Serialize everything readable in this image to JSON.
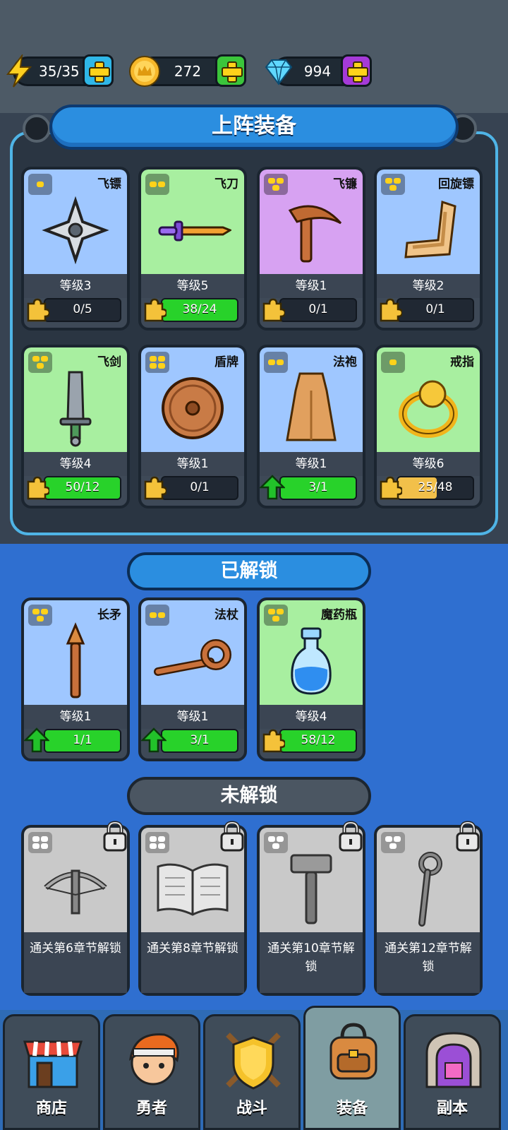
{
  "resources": {
    "energy": "35/35",
    "gold": "272",
    "gems": "994"
  },
  "equipped": {
    "title": "上阵装备",
    "cards": [
      {
        "name": "飞镖",
        "level": "等级3",
        "progress": "0/5",
        "fill": 0,
        "color": "#9fc7ff",
        "rarity": 1,
        "icon": "shuriken-icon"
      },
      {
        "name": "飞刀",
        "level": "等级5",
        "progress": "38/24",
        "fill": 1,
        "color": "#a8efa0",
        "rarity": 2,
        "icon": "dagger-icon"
      },
      {
        "name": "飞镰",
        "level": "等级1",
        "progress": "0/1",
        "fill": 0,
        "color": "#d7a2f2",
        "rarity": 3,
        "icon": "sickle-icon"
      },
      {
        "name": "回旋镖",
        "level": "等级2",
        "progress": "0/1",
        "fill": 0,
        "color": "#9fc7ff",
        "rarity": 3,
        "icon": "boomerang-icon"
      },
      {
        "name": "飞剑",
        "level": "等级4",
        "progress": "50/12",
        "fill": 1,
        "color": "#a8efa0",
        "rarity": 3,
        "icon": "sword-icon"
      },
      {
        "name": "盾牌",
        "level": "等级1",
        "progress": "0/1",
        "fill": 0,
        "color": "#9fc7ff",
        "rarity": 4,
        "icon": "shield-icon"
      },
      {
        "name": "法袍",
        "level": "等级1",
        "progress": "3/1",
        "fill": 1,
        "color": "#9fc7ff",
        "rarity": 2,
        "icon": "robe-icon"
      },
      {
        "name": "戒指",
        "level": "等级6",
        "progress": "25/48",
        "fill": 0.52,
        "color": "#a8efa0",
        "rarity": 1,
        "icon": "ring-icon"
      }
    ]
  },
  "unlocked": {
    "title": "已解锁",
    "cards": [
      {
        "name": "长矛",
        "level": "等级1",
        "progress": "1/1",
        "fill": 1,
        "color": "#9fc7ff",
        "rarity": 3,
        "icon": "spear-icon"
      },
      {
        "name": "法杖",
        "level": "等级1",
        "progress": "3/1",
        "fill": 1,
        "color": "#9fc7ff",
        "rarity": 2,
        "icon": "staff-icon"
      },
      {
        "name": "魔药瓶",
        "level": "等级4",
        "progress": "58/12",
        "fill": 1,
        "color": "#a8efa0",
        "rarity": 3,
        "icon": "potion-icon"
      }
    ]
  },
  "locked": {
    "title": "未解锁",
    "cards": [
      {
        "requirement": "通关第6章节解锁",
        "icon": "crossbow-icon",
        "rarity": 4
      },
      {
        "requirement": "通关第8章节解锁",
        "icon": "book-icon",
        "rarity": 4
      },
      {
        "requirement": "通关第10章节解锁",
        "icon": "hammer-icon",
        "rarity": 3
      },
      {
        "requirement": "通关第12章节解锁",
        "icon": "crook-staff-icon",
        "rarity": 3
      }
    ]
  },
  "nav": [
    {
      "label": "商店",
      "icon": "shop-icon",
      "active": false
    },
    {
      "label": "勇者",
      "icon": "hero-icon",
      "active": false
    },
    {
      "label": "战斗",
      "icon": "battle-icon",
      "active": false
    },
    {
      "label": "装备",
      "icon": "backpack-icon",
      "active": true
    },
    {
      "label": "副本",
      "icon": "dungeon-icon",
      "active": false
    }
  ]
}
